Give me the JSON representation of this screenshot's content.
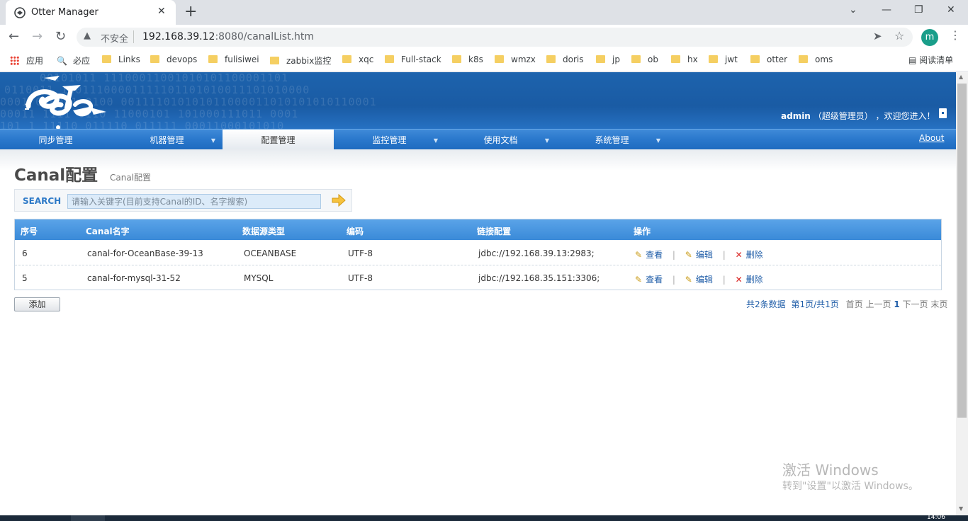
{
  "browser": {
    "tab_title": "Otter Manager",
    "close_glyph": "✕",
    "newtab_glyph": "+",
    "security_label": "不安全",
    "url_host": "192.168.39.12",
    "url_rest": ":8080/canalList.htm",
    "profile_initial": "m",
    "bookmarks": {
      "apps": "应用",
      "bing": "必应",
      "folders": [
        "Links",
        "devops",
        "fulisiwei",
        "zabbix监控",
        "xqc",
        "Full-stack",
        "k8s",
        "wmzx",
        "doris",
        "jp",
        "ob",
        "hx",
        "jwt",
        "otter",
        "oms"
      ]
    },
    "reading_list": "阅读清单"
  },
  "header": {
    "binary_lines": [
      "00101011 11100011001010101100001101",
      "0110011 10011100001111101101010011101010000",
      "0001  010001 0100 001111010101011000011010101010110001",
      "00011  1111  0110 11000101 101000111011 0001",
      "101 1 11110  011110 011111 00011000101010",
      "00010110000  1 0 0001 11100011101"
    ],
    "user_name": "admin",
    "user_role": "（超级管理员）",
    "welcome_text": "，欢迎您进入！"
  },
  "nav": {
    "items": [
      {
        "label": "同步管理",
        "has_caret": false
      },
      {
        "label": "机器管理",
        "has_caret": true
      },
      {
        "label": "配置管理",
        "has_caret": false
      },
      {
        "label": "监控管理",
        "has_caret": true
      },
      {
        "label": "使用文档",
        "has_caret": true
      },
      {
        "label": "系统管理",
        "has_caret": true
      }
    ],
    "active_index": 2,
    "about": "About"
  },
  "page": {
    "title": "Canal配置",
    "subtitle": "Canal配置"
  },
  "search": {
    "label": "SEARCH",
    "placeholder": "请输入关键字(目前支持Canal的ID、名字搜索)"
  },
  "table": {
    "headers": [
      "序号",
      "Canal名字",
      "数据源类型",
      "编码",
      "链接配置",
      "操作"
    ],
    "rows": [
      {
        "id": "6",
        "name": "canal-for-OceanBase-39-13",
        "source_type": "OCEANBASE",
        "encoding": "UTF-8",
        "link": "jdbc://192.168.39.13:2983;"
      },
      {
        "id": "5",
        "name": "canal-for-mysql-31-52",
        "source_type": "MYSQL",
        "encoding": "UTF-8",
        "link": "jdbc://192.168.35.151:3306;"
      }
    ],
    "actions": {
      "view": "查看",
      "edit": "编辑",
      "delete": "删除",
      "sep": "|"
    }
  },
  "footer": {
    "add_button": "添加",
    "pager": {
      "total": "共2条数据",
      "page_info": "第1页/共1页",
      "first": "首页",
      "prev": "上一页",
      "current": "1",
      "next": "下一页",
      "last": "末页"
    }
  },
  "watermark": {
    "line1": "激活 Windows",
    "line2": "转到\"设置\"以激活 Windows。"
  },
  "taskbar": {
    "clock": "14:06"
  },
  "icons": {
    "favicon": "otter-favicon-icon",
    "back": "back-arrow-icon",
    "forward": "forward-arrow-icon",
    "reload": "reload-icon",
    "warning": "warning-triangle-icon",
    "share": "send-icon",
    "bookmark": "star-icon",
    "search_go": "arrow-right-icon",
    "edit": "pencil-icon",
    "delete": "x-mark-icon"
  },
  "colors": {
    "banner": "#1d63ad",
    "nav": "#2a78cc",
    "link": "#1f5da8",
    "delete": "#d8201e"
  }
}
